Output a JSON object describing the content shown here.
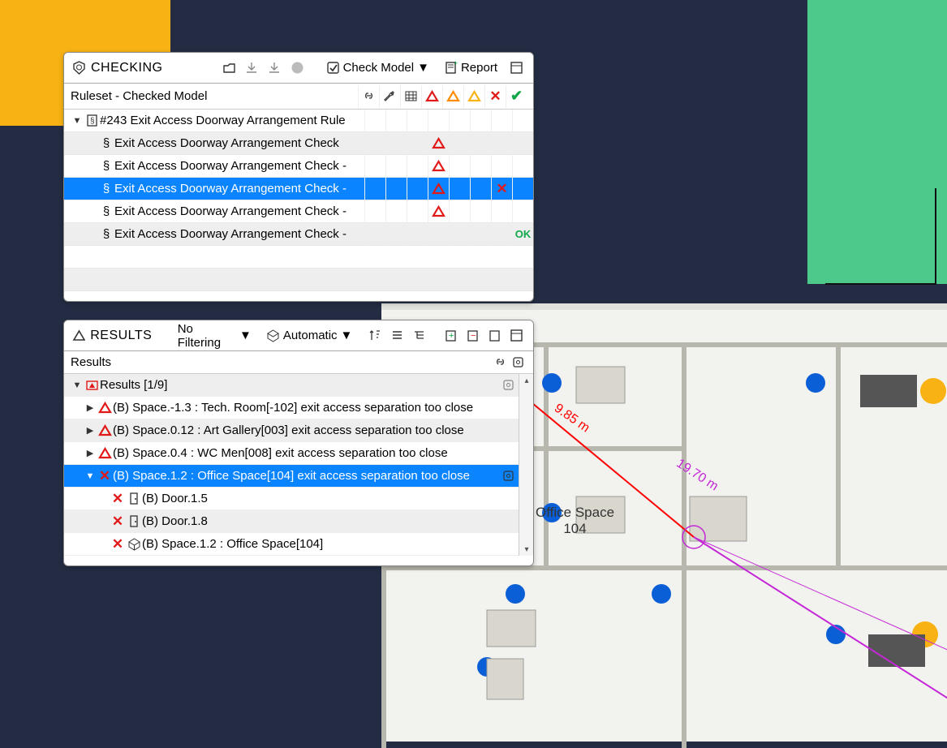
{
  "background": {
    "colors": {
      "page": "#232c43",
      "yellow": "#f8b214",
      "green": "#4dc98b"
    }
  },
  "floorplan": {
    "room_label_line1": "Office Space",
    "room_label_line2": "104",
    "dim1": "9.85 m",
    "dim2": "19.70 m"
  },
  "checking": {
    "title": "CHECKING",
    "buttons": {
      "check_model": "Check Model",
      "report": "Report"
    },
    "header_label": "Ruleset - Checked Model",
    "ruleset": {
      "label": "#243 Exit Access Doorway Arrangement Rule",
      "rows": [
        {
          "label": "Exit Access Doorway Arrangement Check",
          "status": "tri-red",
          "extra": ""
        },
        {
          "label": "Exit Access Doorway Arrangement Check -",
          "status": "tri-red",
          "extra": ""
        },
        {
          "label": "Exit Access Doorway Arrangement Check -",
          "status": "tri-red",
          "extra": "x",
          "selected": true
        },
        {
          "label": "Exit Access Doorway Arrangement Check -",
          "status": "tri-red",
          "extra": ""
        },
        {
          "label": "Exit Access Doorway Arrangement Check -",
          "status": "ok",
          "extra": ""
        }
      ]
    }
  },
  "results": {
    "title": "RESULTS",
    "filter_label": "No Filtering",
    "mode_label": "Automatic",
    "header_label": "Results",
    "tree": {
      "root_label": "Results [1/9]",
      "items": [
        {
          "icon": "tri-red",
          "label": "(B) Space.-1.3 : Tech. Room[-102] exit access separation too close"
        },
        {
          "icon": "tri-red",
          "label": "(B) Space.0.12 : Art Gallery[003] exit access separation too close"
        },
        {
          "icon": "tri-red",
          "label": "(B) Space.0.4 : WC Men[008] exit access separation too close"
        },
        {
          "icon": "x-red",
          "label": "(B) Space.1.2 : Office Space[104] exit access separation too close",
          "selected": true,
          "expanded": true
        }
      ],
      "children": [
        {
          "icon": "x-red",
          "shape": "door",
          "label": "(B) Door.1.5"
        },
        {
          "icon": "x-red",
          "shape": "door",
          "label": "(B) Door.1.8"
        },
        {
          "icon": "x-red",
          "shape": "cube",
          "label": "(B) Space.1.2 : Office Space[104]"
        }
      ]
    }
  }
}
